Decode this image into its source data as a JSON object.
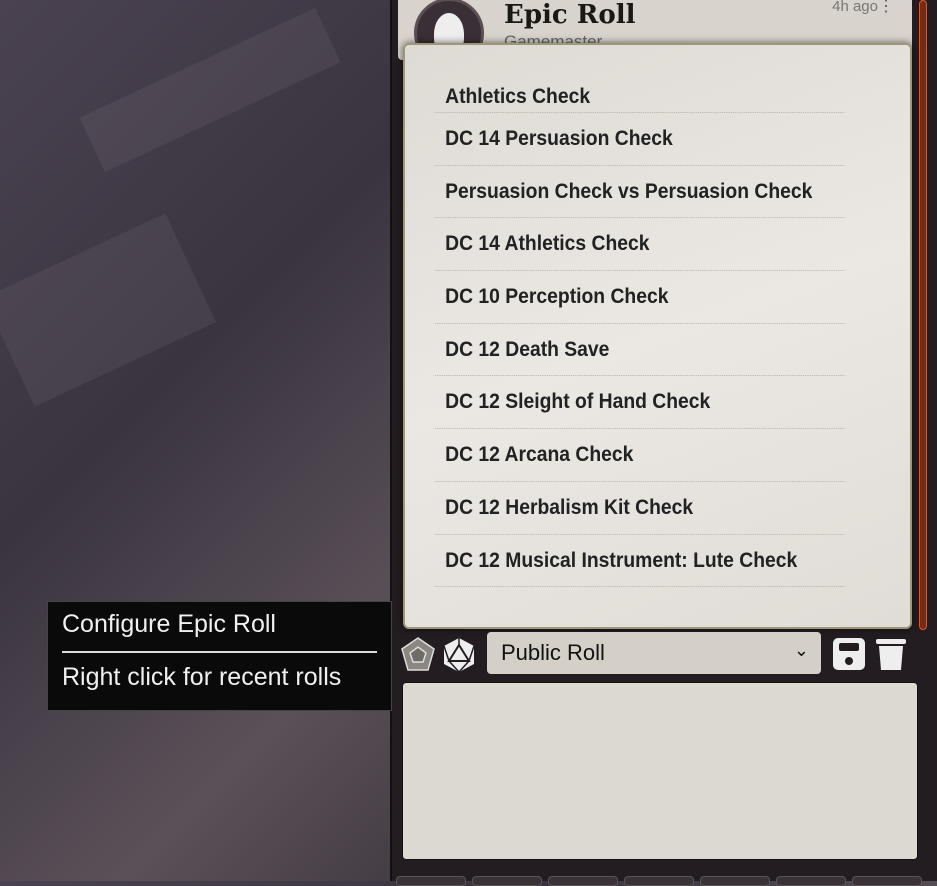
{
  "message": {
    "title": "Epic Roll",
    "subtitle": "Gamemaster",
    "time": "4h ago",
    "avatar_icon": "hooded-figure-icon"
  },
  "roll_menu": {
    "items": [
      "Athletics Check",
      "DC 14 Persuasion Check",
      "Persuasion Check vs Persuasion Check",
      "DC 14 Athletics Check",
      "DC 10 Perception Check",
      "DC 12 Death Save",
      "DC 12 Sleight of Hand Check",
      "DC 12 Arcana Check",
      "DC 12 Herbalism Kit Check",
      "DC 12 Musical Instrument: Lute Check"
    ]
  },
  "tooltip": {
    "line1": "Configure Epic Roll",
    "line2": "Right click for recent rolls"
  },
  "controls": {
    "roll_mode": "Public Roll",
    "icons": [
      "d12-icon",
      "d20-icon",
      "save-icon",
      "trash-icon"
    ]
  },
  "colors": {
    "panel": "#231d22",
    "menu_border": "#9e9678",
    "scrollbar": "#e05a20"
  }
}
